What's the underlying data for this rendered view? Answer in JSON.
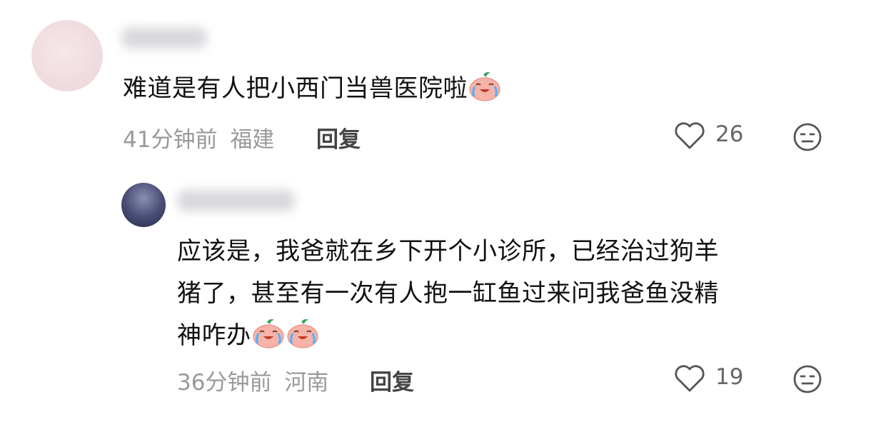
{
  "comments": [
    {
      "text": "难道是有人把小西门当兽医院啦",
      "time": "41分钟前",
      "location": "福建",
      "reply_label": "回复",
      "likes": "26"
    },
    {
      "text_line1": "应该是，我爸就在乡下开个小诊所，已经治过狗羊",
      "text_line2": "猪了，甚至有一次有人抱一缸鱼过来问我爸鱼没精",
      "text_line3": "神咋办",
      "time": "36分钟前",
      "location": "河南",
      "reply_label": "回复",
      "likes": "19"
    }
  ],
  "icons": {
    "like": "heart-outline-icon",
    "dislike": "meh-face-icon",
    "emoji": "crying-peach-emoji"
  },
  "colors": {
    "text": "#111111",
    "meta": "#999999",
    "reply": "#444444",
    "icon": "#555555"
  }
}
